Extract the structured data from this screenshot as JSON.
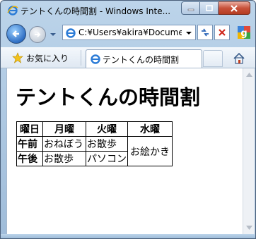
{
  "window": {
    "title": "テントくんの時間割 - Windows Inte..."
  },
  "navigation": {
    "address": "C:¥Users¥akira¥Documen"
  },
  "favorites_bar": {
    "favorites_label": "お気に入り",
    "tab_label": "テントくんの時間割"
  },
  "page": {
    "heading": "テントくんの時間割",
    "table": {
      "headers": [
        "曜日",
        "月曜",
        "火曜",
        "水曜"
      ],
      "rows": [
        {
          "slot": "午前",
          "mon": "おねぼう",
          "tue": "お散歩"
        },
        {
          "slot": "午後",
          "mon": "お散歩",
          "tue": "パソコン"
        }
      ],
      "wed_merged": "お絵かき"
    }
  },
  "colors": {
    "frame": "#9fbcd9",
    "close_button": "#c8513a",
    "link_blue": "#2f6fc4"
  },
  "icons": [
    "ie-icon",
    "back-arrow-icon",
    "forward-arrow-icon",
    "page-icon",
    "refresh-icon",
    "stop-icon",
    "search-provider-icon",
    "favorites-star-icon",
    "home-icon",
    "scroll-up-icon",
    "scroll-down-icon"
  ]
}
